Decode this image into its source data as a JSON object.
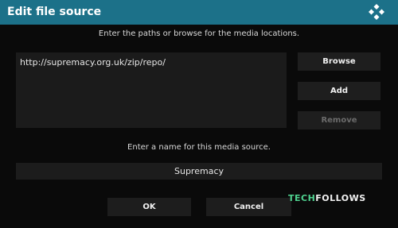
{
  "dialog": {
    "title": "Edit file source",
    "logo_icon": "kodi-logo-icon",
    "paths_instruction": "Enter the paths or browse for the media locations.",
    "paths": [
      "http://supremacy.org.uk/zip/repo/"
    ],
    "buttons": {
      "browse": "Browse",
      "add": "Add",
      "remove": "Remove"
    },
    "name_instruction": "Enter a name for this media source.",
    "name_value": "Supremacy",
    "ok": "OK",
    "cancel": "Cancel"
  },
  "watermark": {
    "part1": "TECH",
    "part2": "FOLLOWS"
  },
  "colors": {
    "titlebar": "#1c7189",
    "background": "#0a0a0a",
    "watermark_green": "#4fd28f"
  }
}
